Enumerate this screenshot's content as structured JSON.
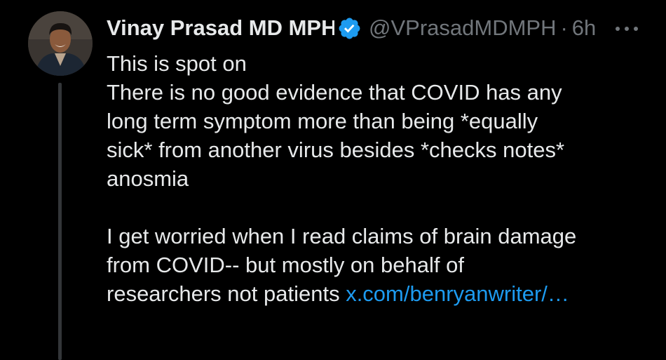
{
  "tweet": {
    "display_name": "Vinay Prasad MD MPH",
    "handle": "@VPrasadMDMPH",
    "separator": "·",
    "time": "6h",
    "lines": [
      "This is spot on",
      "There is no good evidence that COVID has any",
      "long term symptom more than being *equally",
      "sick* from another virus besides *checks notes*",
      "anosmia",
      "",
      "I get worried when I read claims of brain damage",
      "from COVID-- but mostly on behalf of"
    ],
    "last_line_text": "researchers not patients ",
    "link_text": "x.com/benryanwriter/…"
  },
  "icons": {
    "verified": "verified-badge-icon",
    "more": "more-dots-icon"
  },
  "colors": {
    "background": "#000000",
    "text": "#e7e9ea",
    "secondary": "#71767b",
    "link": "#1d9bf0",
    "verified": "#1d9bf0",
    "thread_line": "#333639"
  }
}
